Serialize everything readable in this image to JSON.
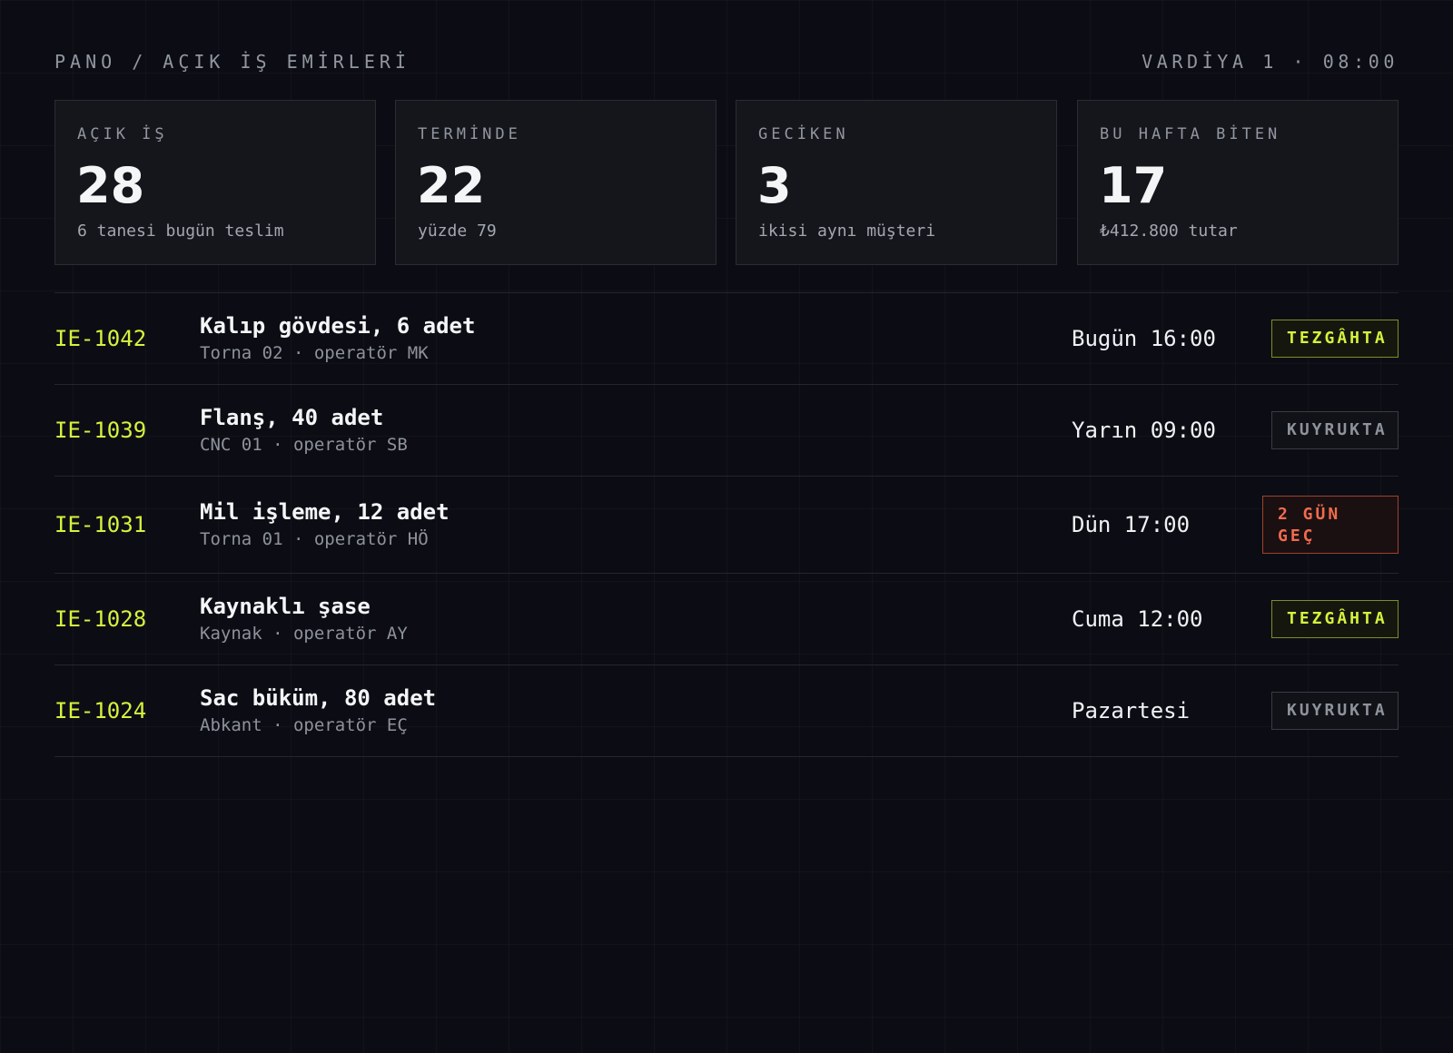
{
  "header": {
    "breadcrumb": "PANO / AÇIK İŞ EMİRLERİ",
    "shift": "VARDİYA 1 · 08:00"
  },
  "stats": [
    {
      "label": "AÇIK İŞ",
      "value": "28",
      "note": "6 tanesi bugün teslim"
    },
    {
      "label": "TERMİNDE",
      "value": "22",
      "note": "yüzde 79"
    },
    {
      "label": "GECİKEN",
      "value": "3",
      "note": "ikisi aynı müşteri"
    },
    {
      "label": "BU HAFTA BİTEN",
      "value": "17",
      "note": "₺412.800 tutar"
    }
  ],
  "orders": [
    {
      "id": "IE-1042",
      "title": "Kalıp gövdesi, 6 adet",
      "meta": "Torna 02 · operatör MK",
      "due": "Bugün 16:00",
      "status": "TEZGÂHTA"
    },
    {
      "id": "IE-1039",
      "title": "Flanş, 40 adet",
      "meta": "CNC 01 · operatör SB",
      "due": "Yarın 09:00",
      "status": "KUYRUKTA"
    },
    {
      "id": "IE-1031",
      "title": "Mil işleme, 12 adet",
      "meta": "Torna 01 · operatör HÖ",
      "due": "Dün 17:00",
      "status": "2 GÜN GEÇ"
    },
    {
      "id": "IE-1028",
      "title": "Kaynaklı şase",
      "meta": "Kaynak · operatör AY",
      "due": "Cuma 12:00",
      "status": "TEZGÂHTA"
    },
    {
      "id": "IE-1024",
      "title": "Sac büküm, 80 adet",
      "meta": "Abkant · operatör EÇ",
      "due": "Pazartesi",
      "status": "KUYRUKTA"
    }
  ],
  "colors": {
    "background": "#0c0d14",
    "accent": "#d6f23d",
    "late": "#f26b4d",
    "muted": "#8e929b"
  }
}
